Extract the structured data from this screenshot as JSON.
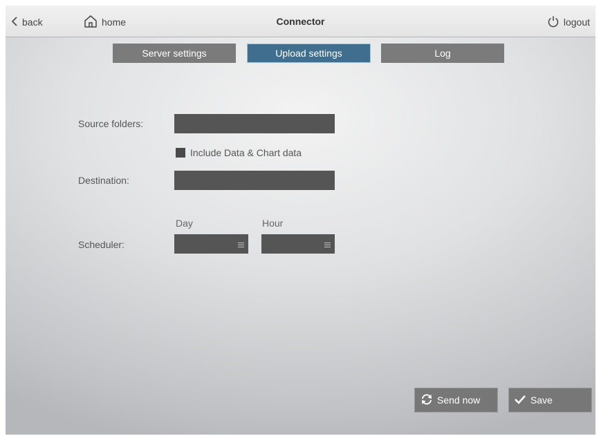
{
  "topbar": {
    "back_label": "back",
    "home_label": "home",
    "title": "Connector",
    "logout_label": "logout"
  },
  "tabs": [
    {
      "label": "Server settings",
      "active": false
    },
    {
      "label": "Upload settings",
      "active": true
    },
    {
      "label": "Log",
      "active": false
    }
  ],
  "form": {
    "source_folders_label": "Source folders:",
    "source_folders_value": "",
    "include_checkbox_label": "Include Data & Chart data",
    "include_checked": true,
    "destination_label": "Destination:",
    "destination_value": "",
    "scheduler_label": "Scheduler:",
    "day_label": "Day",
    "day_value": "",
    "hour_label": "Hour",
    "hour_value": ""
  },
  "actions": {
    "send_now_label": "Send now",
    "save_label": "Save"
  },
  "colors": {
    "active_tab": "#3f6e8e",
    "inactive_tab": "#7b7b7b",
    "field": "#555555",
    "button": "#777777"
  },
  "icons": {
    "back": "chevron-left-icon",
    "home": "home-icon",
    "logout": "power-icon",
    "send": "refresh-icon",
    "save": "checkmark-icon",
    "select": "menu-lines-icon"
  }
}
